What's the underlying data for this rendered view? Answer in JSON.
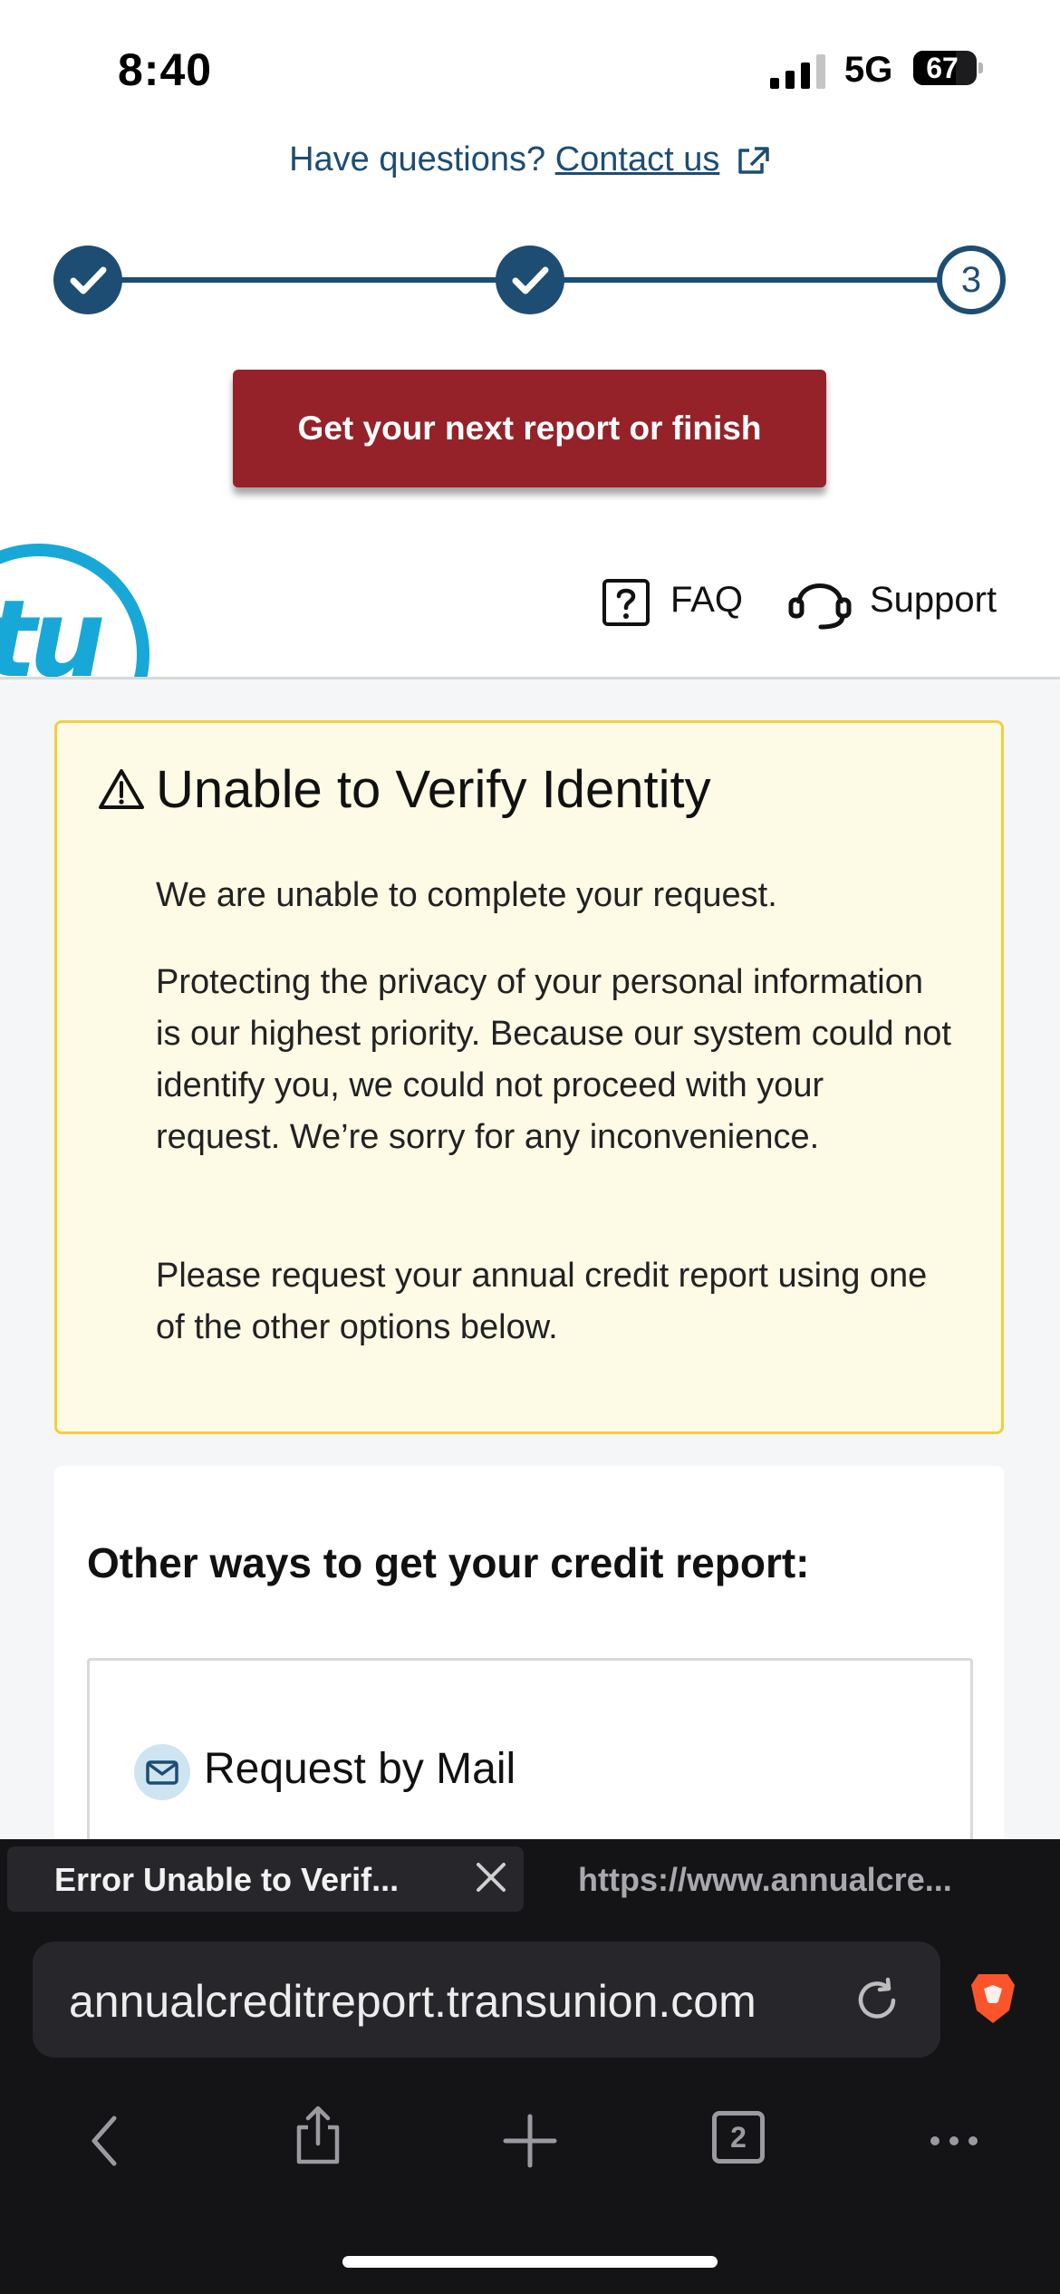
{
  "status_bar": {
    "time": "8:40",
    "network": "5G",
    "battery": "67",
    "battery_level": 0.67
  },
  "contact": {
    "prefix": "Have questions?",
    "link": "Contact us"
  },
  "stepper": {
    "current_step": "3",
    "completed_steps": 2
  },
  "cta": {
    "label": "Get your next report or finish"
  },
  "site_header": {
    "logo": "tu",
    "faq": "FAQ",
    "support": "Support"
  },
  "alert": {
    "title": "Unable to Verify Identity",
    "p1": "We are unable to complete your request.",
    "p2": "Protecting the privacy of your personal information is our highest priority. Because our system could not identify you, we could not proceed with your request. We’re sorry for any inconvenience.",
    "p3": "Please request your annual credit report using one of the other options below."
  },
  "other_ways": {
    "title": "Other ways to get your credit report:",
    "mail_option": "Request by Mail"
  },
  "browser": {
    "active_tab": "Error Unable to Verif...",
    "inactive_tab": "https://www.annualcre...",
    "url": "annualcreditreport.transunion.com",
    "tab_count": "2"
  },
  "colors": {
    "brand_navy": "#1d4d73",
    "cta_red": "#952228",
    "logo_blue": "#17a8d8",
    "alert_bg": "#fdfae6",
    "alert_border": "#f2d03c"
  }
}
